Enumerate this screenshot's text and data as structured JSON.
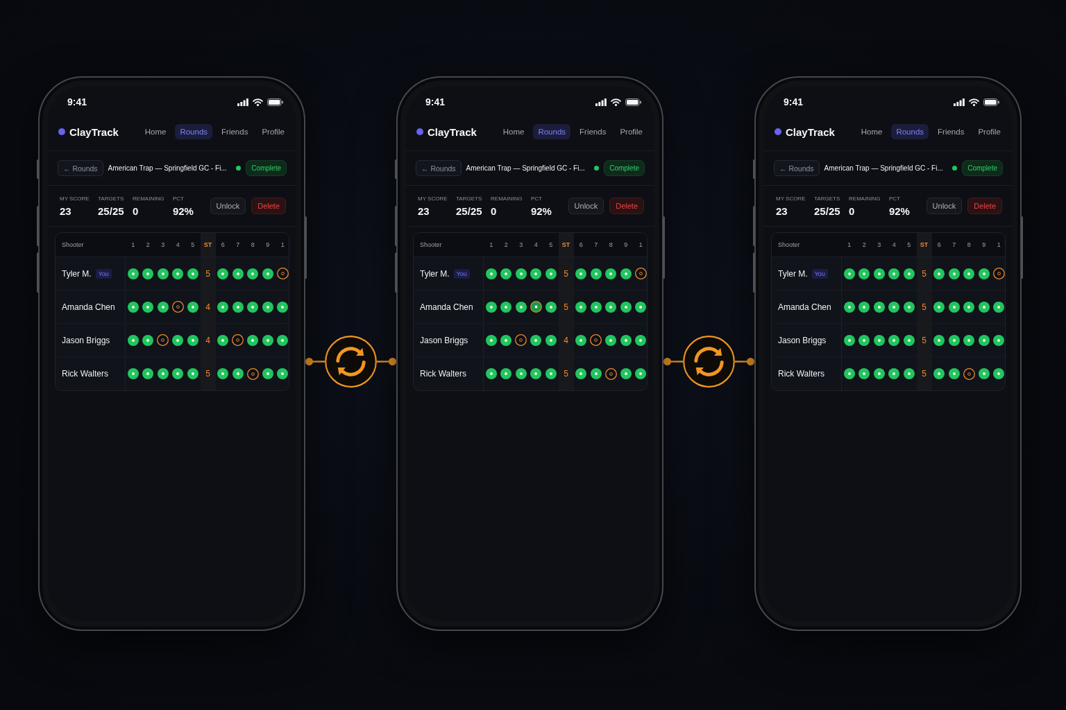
{
  "phones": [
    {
      "status_bar": {
        "time": "9:41"
      },
      "app_header": {
        "logo": "ClayTrack",
        "nav": [
          {
            "label": "Home",
            "selected": false
          },
          {
            "label": "Rounds",
            "selected": true
          },
          {
            "label": "Friends",
            "selected": false
          },
          {
            "label": "Profile",
            "selected": false
          }
        ]
      },
      "round_header": {
        "back": "← Rounds",
        "title": "American Trap — Springfield GC - Fi...",
        "status": "Complete"
      },
      "stats": [
        {
          "label": "MY SCORE",
          "value": "23"
        },
        {
          "label": "TARGETS",
          "value": "25/25"
        },
        {
          "label": "REMAINING",
          "value": "0"
        },
        {
          "label": "PCT",
          "value": "92%"
        }
      ],
      "actions": [
        {
          "label": "Unlock",
          "kind": "neutral"
        },
        {
          "label": "Delete",
          "kind": "danger"
        }
      ],
      "scorecard": {
        "columns": [
          {
            "label": "Shooter",
            "kind": "name"
          },
          {
            "label": "1",
            "kind": "shot"
          },
          {
            "label": "2",
            "kind": "shot"
          },
          {
            "label": "3",
            "kind": "shot"
          },
          {
            "label": "4",
            "kind": "shot"
          },
          {
            "label": "5",
            "kind": "shot"
          },
          {
            "label": "ST",
            "kind": "total"
          },
          {
            "label": "6",
            "kind": "shot"
          },
          {
            "label": "7",
            "kind": "shot"
          },
          {
            "label": "8",
            "kind": "shot"
          },
          {
            "label": "9",
            "kind": "shot"
          },
          {
            "label": "1",
            "kind": "shot"
          }
        ],
        "rows": [
          {
            "name": "Tyler M.",
            "badge": "You",
            "station_total": "5",
            "shots": [
              {
                "kind": "hit"
              },
              {
                "kind": "hit"
              },
              {
                "kind": "hit"
              },
              {
                "kind": "hit"
              },
              {
                "kind": "hit"
              },
              {
                "kind": "hit"
              },
              {
                "kind": "hit"
              },
              {
                "kind": "hit"
              },
              {
                "kind": "hit"
              },
              {
                "kind": "miss"
              }
            ]
          },
          {
            "name": "Amanda Chen",
            "station_total": "4",
            "shots": [
              {
                "kind": "hit"
              },
              {
                "kind": "hit"
              },
              {
                "kind": "hit"
              },
              {
                "kind": "miss"
              },
              {
                "kind": "hit"
              },
              {
                "kind": "hit"
              },
              {
                "kind": "hit"
              },
              {
                "kind": "hit"
              },
              {
                "kind": "hit"
              },
              {
                "kind": "hit"
              }
            ]
          },
          {
            "name": "Jason Briggs",
            "station_total": "4",
            "shots": [
              {
                "kind": "hit"
              },
              {
                "kind": "hit"
              },
              {
                "kind": "miss"
              },
              {
                "kind": "hit"
              },
              {
                "kind": "hit"
              },
              {
                "kind": "hit"
              },
              {
                "kind": "miss"
              },
              {
                "kind": "hit"
              },
              {
                "kind": "hit"
              },
              {
                "kind": "hit"
              }
            ]
          },
          {
            "name": "Rick Walters",
            "station_total": "5",
            "shots": [
              {
                "kind": "hit"
              },
              {
                "kind": "hit"
              },
              {
                "kind": "hit"
              },
              {
                "kind": "hit"
              },
              {
                "kind": "hit"
              },
              {
                "kind": "hit"
              },
              {
                "kind": "hit"
              },
              {
                "kind": "miss"
              },
              {
                "kind": "hit"
              },
              {
                "kind": "hit"
              }
            ]
          }
        ]
      }
    },
    {
      "status_bar": {
        "time": "9:41"
      },
      "app_header": {
        "logo": "ClayTrack",
        "nav": [
          {
            "label": "Home",
            "selected": false
          },
          {
            "label": "Rounds",
            "selected": true
          },
          {
            "label": "Friends",
            "selected": false
          },
          {
            "label": "Profile",
            "selected": false
          }
        ]
      },
      "round_header": {
        "back": "← Rounds",
        "title": "American Trap — Springfield GC - Fi...",
        "status": "Complete"
      },
      "stats": [
        {
          "label": "MY SCORE",
          "value": "23"
        },
        {
          "label": "TARGETS",
          "value": "25/25"
        },
        {
          "label": "REMAINING",
          "value": "0"
        },
        {
          "label": "PCT",
          "value": "92%"
        }
      ],
      "actions": [
        {
          "label": "Unlock",
          "kind": "neutral"
        },
        {
          "label": "Delete",
          "kind": "danger"
        }
      ],
      "scorecard": {
        "columns": [
          {
            "label": "Shooter",
            "kind": "name"
          },
          {
            "label": "1",
            "kind": "shot"
          },
          {
            "label": "2",
            "kind": "shot"
          },
          {
            "label": "3",
            "kind": "shot"
          },
          {
            "label": "4",
            "kind": "shot"
          },
          {
            "label": "5",
            "kind": "shot"
          },
          {
            "label": "ST",
            "kind": "total"
          },
          {
            "label": "6",
            "kind": "shot"
          },
          {
            "label": "7",
            "kind": "shot"
          },
          {
            "label": "8",
            "kind": "shot"
          },
          {
            "label": "9",
            "kind": "shot"
          },
          {
            "label": "1",
            "kind": "shot"
          }
        ],
        "rows": [
          {
            "name": "Tyler M.",
            "badge": "You",
            "station_total": "5",
            "shots": [
              {
                "kind": "hit"
              },
              {
                "kind": "hit"
              },
              {
                "kind": "hit"
              },
              {
                "kind": "hit"
              },
              {
                "kind": "hit"
              },
              {
                "kind": "hit"
              },
              {
                "kind": "hit"
              },
              {
                "kind": "hit"
              },
              {
                "kind": "hit"
              },
              {
                "kind": "miss"
              }
            ]
          },
          {
            "name": "Amanda Chen",
            "station_total": "5",
            "shots": [
              {
                "kind": "hit"
              },
              {
                "kind": "hit"
              },
              {
                "kind": "hit"
              },
              {
                "kind": "changed"
              },
              {
                "kind": "hit"
              },
              {
                "kind": "hit"
              },
              {
                "kind": "hit"
              },
              {
                "kind": "hit"
              },
              {
                "kind": "hit"
              },
              {
                "kind": "hit"
              }
            ]
          },
          {
            "name": "Jason Briggs",
            "station_total": "4",
            "shots": [
              {
                "kind": "hit"
              },
              {
                "kind": "hit"
              },
              {
                "kind": "miss"
              },
              {
                "kind": "hit"
              },
              {
                "kind": "hit"
              },
              {
                "kind": "hit"
              },
              {
                "kind": "miss"
              },
              {
                "kind": "hit"
              },
              {
                "kind": "hit"
              },
              {
                "kind": "hit"
              }
            ]
          },
          {
            "name": "Rick Walters",
            "station_total": "5",
            "shots": [
              {
                "kind": "hit"
              },
              {
                "kind": "hit"
              },
              {
                "kind": "hit"
              },
              {
                "kind": "hit"
              },
              {
                "kind": "hit"
              },
              {
                "kind": "hit"
              },
              {
                "kind": "hit"
              },
              {
                "kind": "miss"
              },
              {
                "kind": "hit"
              },
              {
                "kind": "hit"
              }
            ]
          }
        ]
      }
    },
    {
      "status_bar": {
        "time": "9:41"
      },
      "app_header": {
        "logo": "ClayTrack",
        "nav": [
          {
            "label": "Home",
            "selected": false
          },
          {
            "label": "Rounds",
            "selected": true
          },
          {
            "label": "Friends",
            "selected": false
          },
          {
            "label": "Profile",
            "selected": false
          }
        ]
      },
      "round_header": {
        "back": "← Rounds",
        "title": "American Trap — Springfield GC - Fi...",
        "status": "Complete"
      },
      "stats": [
        {
          "label": "MY SCORE",
          "value": "23"
        },
        {
          "label": "TARGETS",
          "value": "25/25"
        },
        {
          "label": "REMAINING",
          "value": "0"
        },
        {
          "label": "PCT",
          "value": "92%"
        }
      ],
      "actions": [
        {
          "label": "Unlock",
          "kind": "neutral"
        },
        {
          "label": "Delete",
          "kind": "danger"
        }
      ],
      "scorecard": {
        "columns": [
          {
            "label": "Shooter",
            "kind": "name"
          },
          {
            "label": "1",
            "kind": "shot"
          },
          {
            "label": "2",
            "kind": "shot"
          },
          {
            "label": "3",
            "kind": "shot"
          },
          {
            "label": "4",
            "kind": "shot"
          },
          {
            "label": "5",
            "kind": "shot"
          },
          {
            "label": "ST",
            "kind": "total"
          },
          {
            "label": "6",
            "kind": "shot"
          },
          {
            "label": "7",
            "kind": "shot"
          },
          {
            "label": "8",
            "kind": "shot"
          },
          {
            "label": "9",
            "kind": "shot"
          },
          {
            "label": "1",
            "kind": "shot"
          }
        ],
        "rows": [
          {
            "name": "Tyler M.",
            "badge": "You",
            "station_total": "5",
            "shots": [
              {
                "kind": "hit"
              },
              {
                "kind": "hit"
              },
              {
                "kind": "hit"
              },
              {
                "kind": "hit"
              },
              {
                "kind": "hit"
              },
              {
                "kind": "hit"
              },
              {
                "kind": "hit"
              },
              {
                "kind": "hit"
              },
              {
                "kind": "hit"
              },
              {
                "kind": "miss"
              }
            ]
          },
          {
            "name": "Amanda Chen",
            "station_total": "5",
            "shots": [
              {
                "kind": "hit"
              },
              {
                "kind": "hit"
              },
              {
                "kind": "hit"
              },
              {
                "kind": "hit"
              },
              {
                "kind": "hit"
              },
              {
                "kind": "hit"
              },
              {
                "kind": "hit"
              },
              {
                "kind": "hit"
              },
              {
                "kind": "hit"
              },
              {
                "kind": "hit"
              }
            ]
          },
          {
            "name": "Jason Briggs",
            "station_total": "5",
            "shots": [
              {
                "kind": "hit"
              },
              {
                "kind": "hit"
              },
              {
                "kind": "hit"
              },
              {
                "kind": "hit"
              },
              {
                "kind": "hit"
              },
              {
                "kind": "hit"
              },
              {
                "kind": "hit"
              },
              {
                "kind": "hit"
              },
              {
                "kind": "hit"
              },
              {
                "kind": "hit"
              }
            ]
          },
          {
            "name": "Rick Walters",
            "station_total": "5",
            "shots": [
              {
                "kind": "hit"
              },
              {
                "kind": "hit"
              },
              {
                "kind": "hit"
              },
              {
                "kind": "hit"
              },
              {
                "kind": "hit"
              },
              {
                "kind": "hit"
              },
              {
                "kind": "hit"
              },
              {
                "kind": "miss"
              },
              {
                "kind": "hit"
              },
              {
                "kind": "hit"
              }
            ]
          }
        ]
      }
    }
  ]
}
